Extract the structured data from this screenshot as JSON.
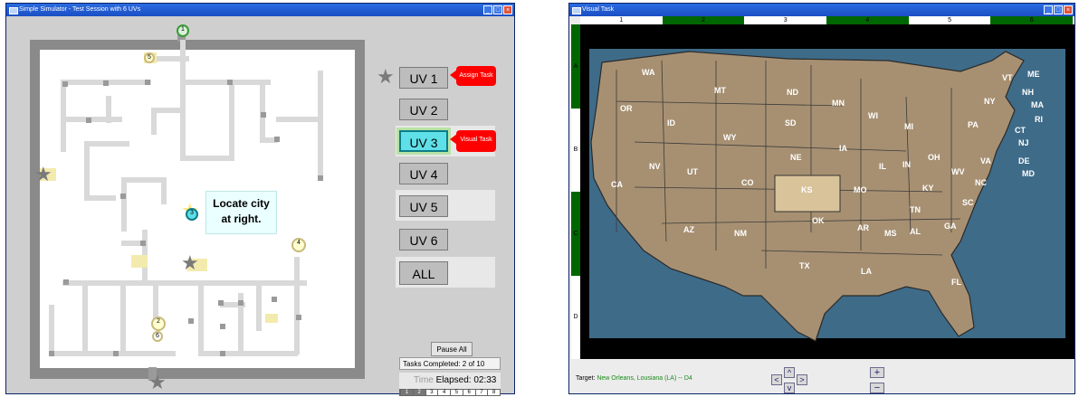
{
  "sim_window": {
    "title": "Simple Simulator - Test Session with 6 UVs",
    "uv_labels": [
      "UV 1",
      "UV 2",
      "UV 3",
      "UV 4",
      "UV 5",
      "UV 6"
    ],
    "all_label": "ALL",
    "assign_task_label": "Assign Task",
    "visual_task_label": "Visual Task",
    "callout_line1": "Locate city",
    "callout_line2": "at right.",
    "map_markers": [
      "1",
      "2",
      "3",
      "4",
      "5",
      "6"
    ],
    "pause_label": "Pause All",
    "tasks_completed": "Tasks Completed: 2 of 10",
    "time_label": "Time",
    "elapsed": "Elapsed: 02:33",
    "timeline_ticks": [
      "1",
      "2",
      "3",
      "4",
      "5",
      "6",
      "7",
      "8"
    ]
  },
  "visual_task_window": {
    "title": "Visual Task",
    "column_labels": [
      "1",
      "2",
      "3",
      "4",
      "5",
      "6"
    ],
    "row_labels": [
      "A",
      "B",
      "C",
      "D"
    ],
    "states": [
      "WA",
      "OR",
      "ID",
      "MT",
      "ND",
      "MN",
      "SD",
      "WY",
      "NE",
      "IA",
      "WI",
      "MI",
      "NV",
      "UT",
      "CO",
      "KS",
      "MO",
      "IL",
      "IN",
      "OH",
      "CA",
      "AZ",
      "NM",
      "OK",
      "AR",
      "KY",
      "WV",
      "TN",
      "TX",
      "LA",
      "MS",
      "AL",
      "GA",
      "SC",
      "NC",
      "VA",
      "FL",
      "PA",
      "NY",
      "VT",
      "ME",
      "NH",
      "MA",
      "RI",
      "CT",
      "NJ",
      "DE",
      "MD"
    ],
    "target_label": "Target:",
    "target_value": "New Orleans, Lousiana (LA) -- D4",
    "zoom_in": "+",
    "zoom_out": "−",
    "pan_up": "^",
    "pan_down": "v",
    "pan_left": "<",
    "pan_right": ">"
  },
  "colors": {
    "accent_red": "#ff0000",
    "selected_uv": "#5fe0e8",
    "grid_green": "#006600",
    "target_green": "#1a8a1a"
  }
}
